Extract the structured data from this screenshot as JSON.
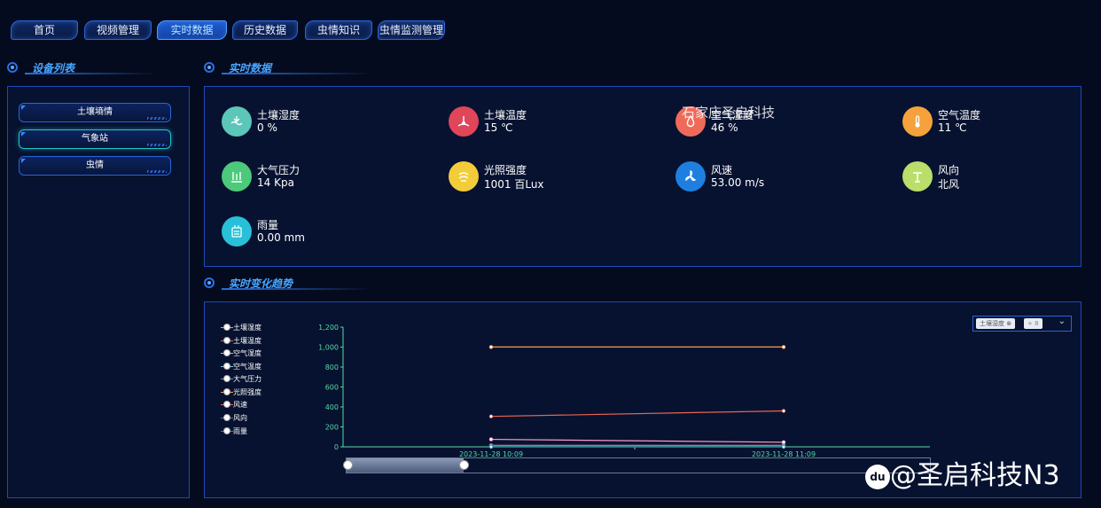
{
  "nav": {
    "tabs": [
      {
        "label": "首页"
      },
      {
        "label": "视频管理"
      },
      {
        "label": "实时数据"
      },
      {
        "label": "历史数据"
      },
      {
        "label": "虫情知识"
      },
      {
        "label": "虫情监测管理"
      }
    ],
    "active_tab": "实时数据"
  },
  "device_list": {
    "title": "设备列表",
    "items": [
      {
        "label": "土壤墒情"
      },
      {
        "label": "气象站"
      },
      {
        "label": "虫情"
      }
    ],
    "active_item": "气象站"
  },
  "realtime": {
    "title": "实时数据",
    "overlay_text": "石家庄圣启科技",
    "metrics": [
      {
        "label": "土壤湿度",
        "value": "0 %",
        "icon": "soil-moisture-icon",
        "color": "#5cc6b8"
      },
      {
        "label": "土壤温度",
        "value": "15 ℃",
        "icon": "soil-temperature-icon",
        "color": "#e0455a"
      },
      {
        "label": "空气湿度",
        "value": "46 %",
        "icon": "air-humidity-icon",
        "color": "#f06a5a"
      },
      {
        "label": "空气温度",
        "value": "11 ℃",
        "icon": "air-temperature-icon",
        "color": "#f5a23c"
      },
      {
        "label": "大气压力",
        "value": "14 Kpa",
        "icon": "pressure-icon",
        "color": "#4cc97a"
      },
      {
        "label": "光照强度",
        "value": "1001 百Lux",
        "icon": "light-icon",
        "color": "#f3cc3a"
      },
      {
        "label": "风速",
        "value": "53.00 m/s",
        "icon": "wind-speed-icon",
        "color": "#1f7fe0"
      },
      {
        "label": "风向",
        "value": "北风",
        "icon": "wind-direction-icon",
        "color": "#b9de6a"
      },
      {
        "label": "雨量",
        "value": "0.00 mm",
        "icon": "rain-icon",
        "color": "#27c0d8"
      }
    ]
  },
  "trend": {
    "title": "实时变化趋势",
    "selector": {
      "tag": "土壤湿度",
      "more": "+ 8"
    }
  },
  "chart_data": {
    "type": "line",
    "x": [
      "2023-11-28 10:09",
      "2023-11-28 11:09"
    ],
    "ylim": [
      0,
      1200
    ],
    "yticks": [
      "0",
      "200",
      "400",
      "600",
      "800",
      "1,000",
      "1,200"
    ],
    "legend_position": "left",
    "series": [
      {
        "name": "土壤湿度",
        "values": [
          0,
          0
        ],
        "color": "#5ad8a6"
      },
      {
        "name": "土壤温度",
        "values": [
          15,
          15
        ],
        "color": "#e86452"
      },
      {
        "name": "空气湿度",
        "values": [
          75,
          46
        ],
        "color": "#ff9cc8"
      },
      {
        "name": "空气温度",
        "values": [
          12,
          11
        ],
        "color": "#6dc8ec"
      },
      {
        "name": "大气压力",
        "values": [
          14,
          14
        ],
        "color": "#5b8ff9"
      },
      {
        "name": "光照强度",
        "values": [
          1001,
          1001
        ],
        "color": "#ff9845"
      },
      {
        "name": "风速",
        "values": [
          305,
          360
        ],
        "color": "#e86452"
      },
      {
        "name": "风向",
        "values": [
          5,
          5
        ],
        "color": "#5d7092"
      },
      {
        "name": "雨量",
        "values": [
          0,
          0
        ],
        "color": "#1e9493"
      }
    ]
  },
  "watermark": "@圣启科技N3"
}
